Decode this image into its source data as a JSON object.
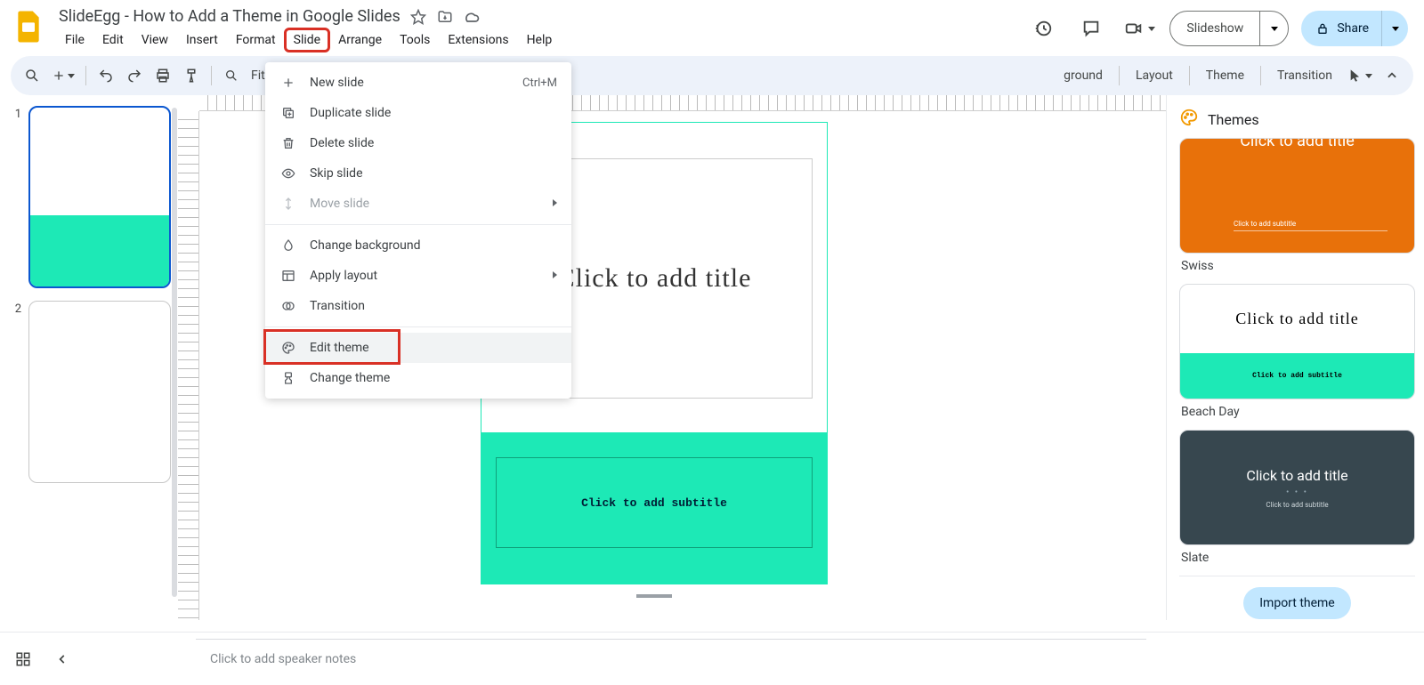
{
  "doc_title": "SlideEgg - How to Add a Theme in Google Slides",
  "menubar": [
    "File",
    "Edit",
    "View",
    "Insert",
    "Format",
    "Slide",
    "Arrange",
    "Tools",
    "Extensions",
    "Help"
  ],
  "menubar_highlight_index": 5,
  "header_buttons": {
    "slideshow": "Slideshow",
    "share": "Share"
  },
  "toolbar": {
    "fit": "Fit",
    "right_labels": [
      "ground",
      "Layout",
      "Theme",
      "Transition"
    ]
  },
  "filmstrip": [
    {
      "num": "1",
      "active": true,
      "teal_lower": true
    },
    {
      "num": "2",
      "active": false,
      "teal_lower": false
    }
  ],
  "slide": {
    "title_placeholder": "Click to add title",
    "subtitle_placeholder": "Click to add subtitle"
  },
  "themes_panel": {
    "title": "Themes",
    "items": [
      {
        "key": "swiss",
        "label": "Swiss",
        "title": "Click to add title",
        "sub": "Click to add subtitle"
      },
      {
        "key": "beach",
        "label": "Beach Day",
        "title": "Click to add title",
        "sub": "Click to add subtitle"
      },
      {
        "key": "slate",
        "label": "Slate",
        "title": "Click to add title",
        "sub": "Click to add subtitle"
      }
    ],
    "import_label": "Import theme"
  },
  "notes_placeholder": "Click to add speaker notes",
  "dropdown": {
    "items": [
      {
        "icon": "plus",
        "label": "New slide",
        "shortcut": "Ctrl+M"
      },
      {
        "icon": "duplicate",
        "label": "Duplicate slide"
      },
      {
        "icon": "trash",
        "label": "Delete slide"
      },
      {
        "icon": "eye",
        "label": "Skip slide"
      },
      {
        "icon": "move",
        "label": "Move slide",
        "disabled": true,
        "submenu": true
      },
      {
        "sep": true
      },
      {
        "icon": "droplet",
        "label": "Change background"
      },
      {
        "icon": "layout",
        "label": "Apply layout",
        "submenu": true
      },
      {
        "icon": "transition",
        "label": "Transition"
      },
      {
        "sep": true
      },
      {
        "icon": "palette",
        "label": "Edit theme",
        "hover": true,
        "highlight": true
      },
      {
        "icon": "brush",
        "label": "Change theme"
      }
    ]
  }
}
